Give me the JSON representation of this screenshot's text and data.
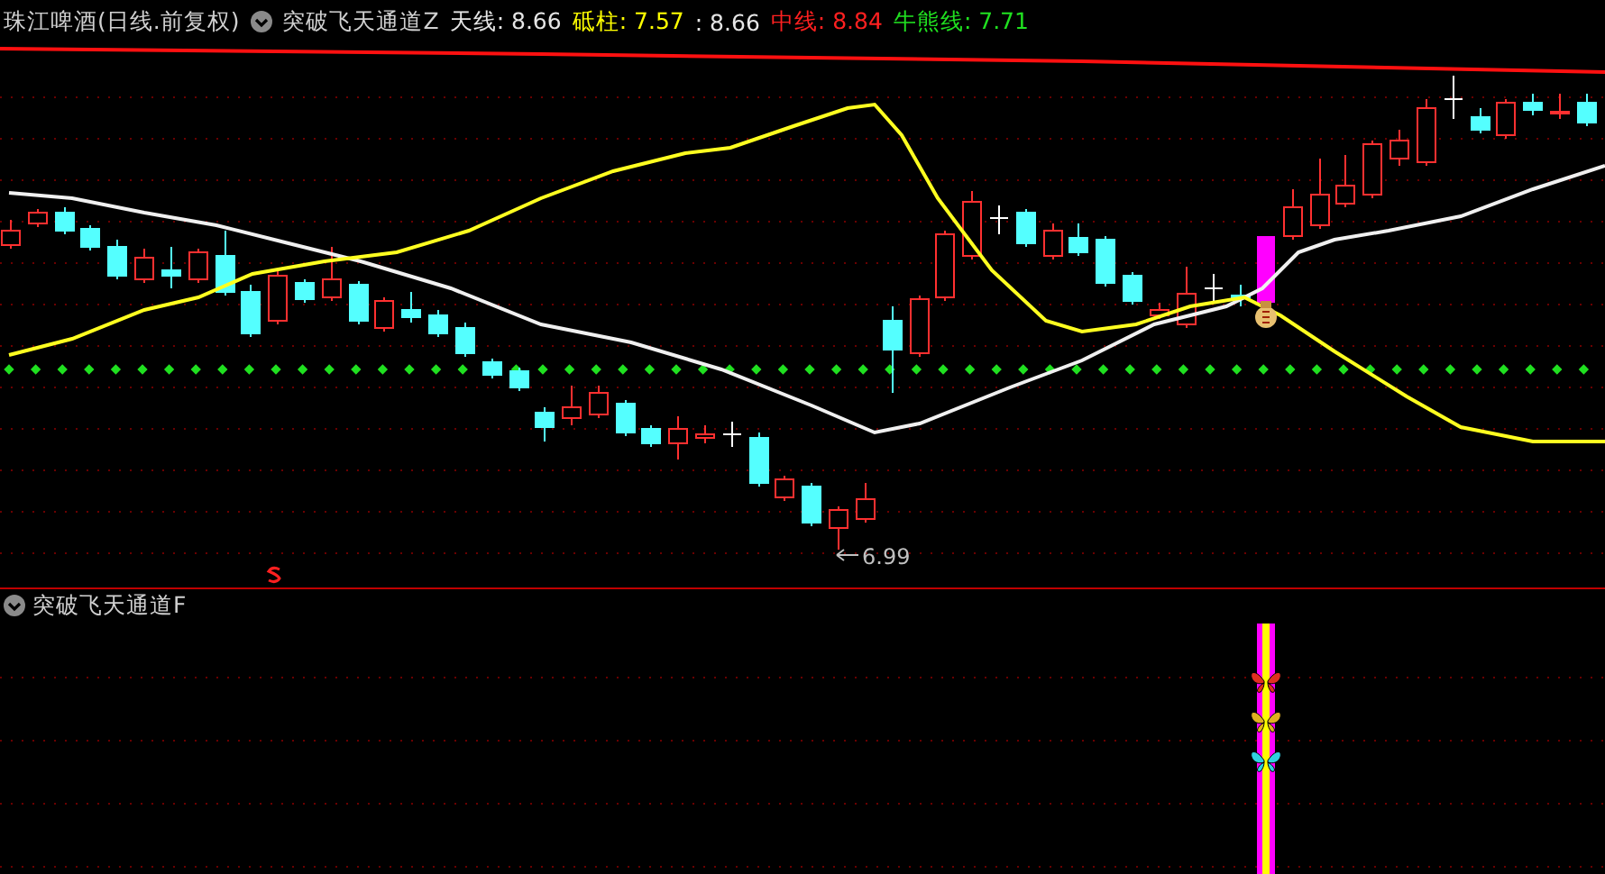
{
  "header": {
    "title": "珠江啤酒(日线.前复权)",
    "indicator": "突破飞天通道Z",
    "legend": [
      {
        "label": "天线:",
        "value": "8.66",
        "color": "#e6e6e6"
      },
      {
        "label": "砥柱:",
        "value": "7.57",
        "color": "#ffff00"
      },
      {
        "label": ":",
        "value": "8.66",
        "color": "#e6e6e6"
      },
      {
        "label": "中线:",
        "value": "8.84",
        "color": "#ff2020"
      },
      {
        "label": "牛熊线:",
        "value": "7.71",
        "color": "#20e020"
      }
    ]
  },
  "main_chart": {
    "low_label": "6.99"
  },
  "sub_panel": {
    "indicator": "突破飞天通道F"
  }
}
